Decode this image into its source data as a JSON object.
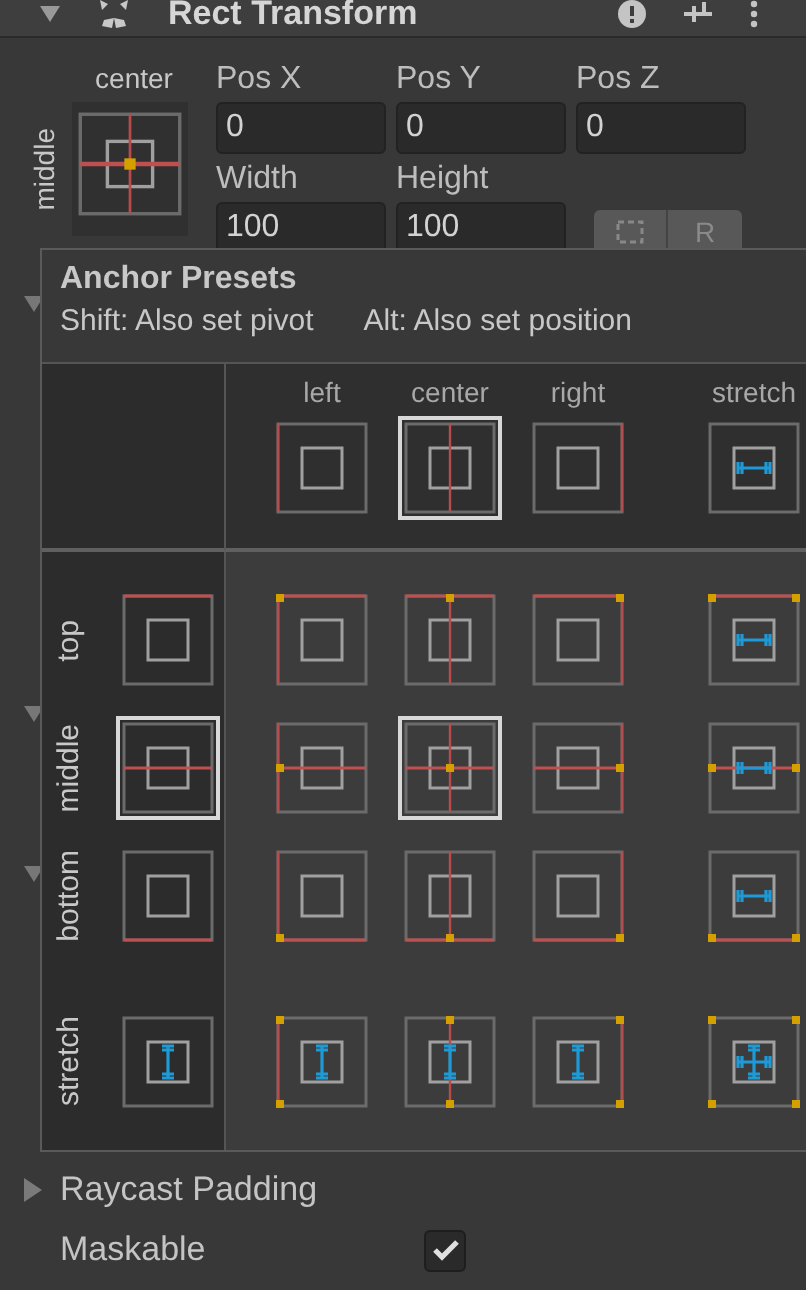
{
  "component": {
    "title": "Rect Transform",
    "expanded": true
  },
  "anchor": {
    "column_label": "center",
    "row_label": "middle"
  },
  "fields": [
    {
      "label": "Pos X",
      "value": "0"
    },
    {
      "label": "Pos Y",
      "value": "0"
    },
    {
      "label": "Pos Z",
      "value": "0"
    },
    {
      "label": "Width",
      "value": "100"
    },
    {
      "label": "Height",
      "value": "100"
    }
  ],
  "raw_button": "R",
  "presets": {
    "title": "Anchor Presets",
    "hints": [
      "Shift: Also set pivot",
      "Alt: Also set position"
    ],
    "columns": [
      {
        "label": "left",
        "kind": "left",
        "selected": false
      },
      {
        "label": "center",
        "kind": "center",
        "selected": true
      },
      {
        "label": "right",
        "kind": "right",
        "selected": false
      },
      {
        "label": "stretch",
        "kind": "stretch",
        "selected": false
      }
    ],
    "rows": [
      {
        "label": "top",
        "kind": "top",
        "selected": false,
        "cells": [
          {
            "selected": false
          },
          {
            "selected": false
          },
          {
            "selected": false
          },
          {
            "selected": false
          }
        ]
      },
      {
        "label": "middle",
        "kind": "middle",
        "selected": true,
        "cells": [
          {
            "selected": false
          },
          {
            "selected": true
          },
          {
            "selected": false
          },
          {
            "selected": false
          }
        ]
      },
      {
        "label": "bottom",
        "kind": "bottom",
        "selected": false,
        "cells": [
          {
            "selected": false
          },
          {
            "selected": false
          },
          {
            "selected": false
          },
          {
            "selected": false
          }
        ]
      },
      {
        "label": "stretch",
        "kind": "stretch",
        "selected": false,
        "cells": [
          {
            "selected": false
          },
          {
            "selected": false
          },
          {
            "selected": false
          },
          {
            "selected": false
          }
        ]
      }
    ]
  },
  "properties": [
    {
      "kind": "foldout",
      "label": "Raycast Padding",
      "expanded": false
    },
    {
      "kind": "checkbox",
      "label": "Maskable",
      "checked": true
    }
  ]
}
